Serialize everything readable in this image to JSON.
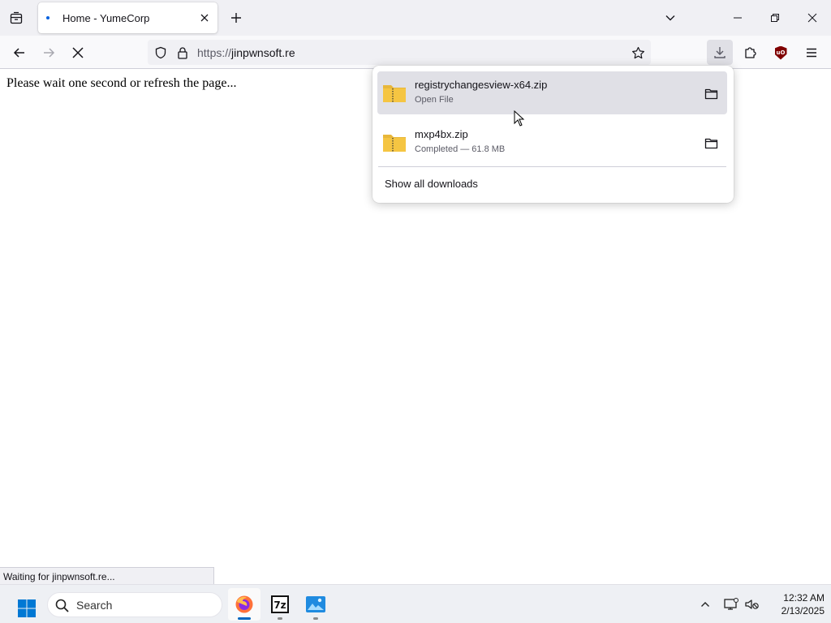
{
  "browser": {
    "tab": {
      "title": "Home - YumeCorp"
    },
    "url": {
      "scheme": "https://",
      "host": "jinpwnsoft.re"
    }
  },
  "page": {
    "message": "Please wait one second or refresh the page..."
  },
  "downloads": {
    "items": [
      {
        "name": "registrychangesview-x64.zip",
        "status": "Open File"
      },
      {
        "name": "mxp4bx.zip",
        "status": "Completed — 61.8 MB"
      }
    ],
    "show_all": "Show all downloads"
  },
  "status_bar": {
    "text": "Waiting for jinpwnsoft.re..."
  },
  "taskbar": {
    "search_placeholder": "Search",
    "apps": [
      "firefox",
      "7-zip",
      "photos"
    ],
    "clock": {
      "time": "12:32 AM",
      "date": "2/13/2025"
    }
  },
  "colors": {
    "accent": "#0060df",
    "ublock": "#800000",
    "zip_folder": "#f5c542"
  }
}
